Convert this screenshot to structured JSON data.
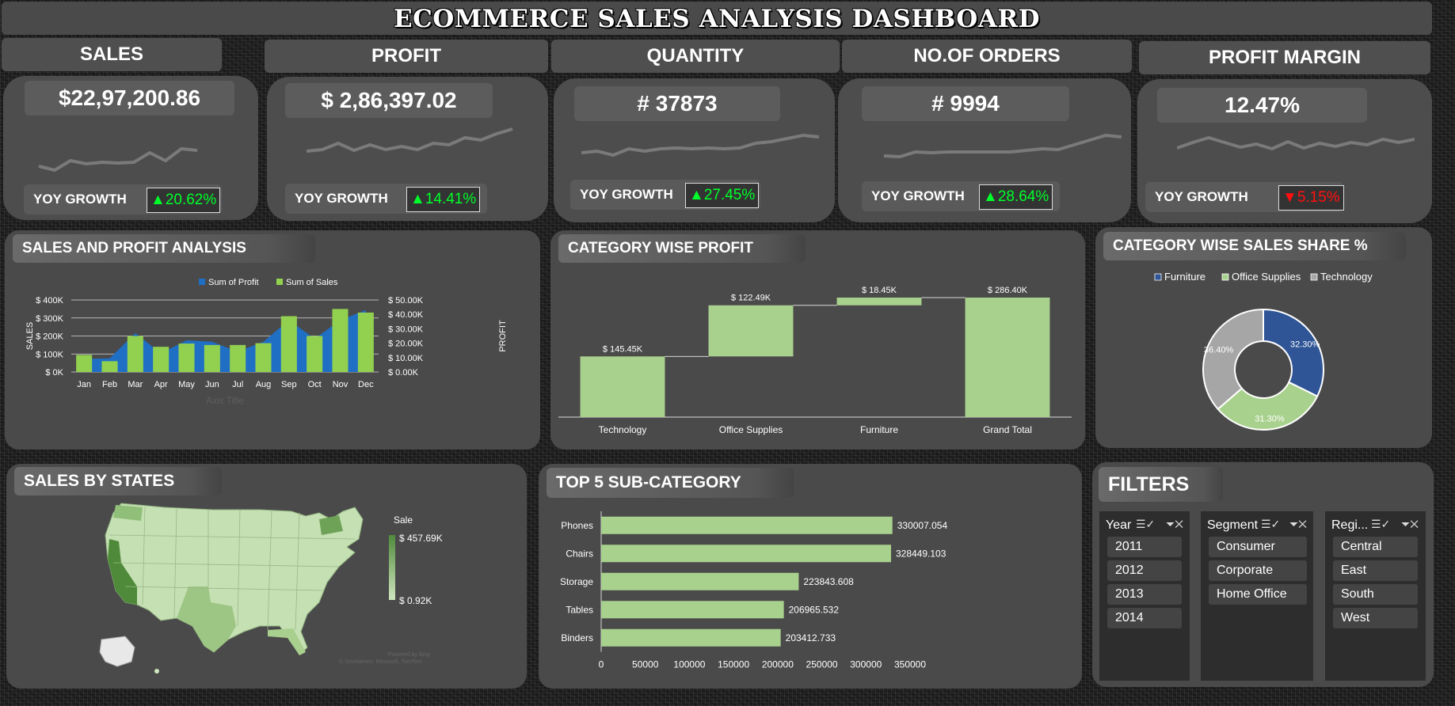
{
  "dashboard": {
    "title": "ECOMMERCE SALES ANALYSIS DASHBOARD"
  },
  "kpis": [
    {
      "label": "SALES",
      "value": "$22,97,200.86",
      "yoy_label": "YOY GROWTH",
      "yoy": "20.62%",
      "direction": "up",
      "color": "#00ff2a"
    },
    {
      "label": "PROFIT",
      "value": "$  2,86,397.02",
      "yoy_label": "YOY GROWTH",
      "yoy": "14.41%",
      "direction": "up",
      "color": "#00ff2a"
    },
    {
      "label": "QUANTITY",
      "value": "# 37873",
      "yoy_label": "YOY GROWTH",
      "yoy": "27.45%",
      "direction": "up",
      "color": "#00ff2a"
    },
    {
      "label": "NO.OF ORDERS",
      "value": "# 9994",
      "yoy_label": "YOY GROWTH",
      "yoy": "28.64%",
      "direction": "up",
      "color": "#00ff2a"
    },
    {
      "label": "PROFIT MARGIN",
      "value": "12.47%",
      "yoy_label": "YOY GROWTH",
      "yoy": "5.15%",
      "direction": "down",
      "color": "#ff1010"
    }
  ],
  "panels": {
    "sales_profit": "SALES AND PROFIT ANALYSIS",
    "category_profit": "CATEGORY WISE PROFIT",
    "category_share": "CATEGORY WISE SALES SHARE %",
    "states": "SALES BY STATES",
    "top5": "TOP 5 SUB-CATEGORY",
    "filters": "FILTERS"
  },
  "map": {
    "legend_title": "Sale",
    "legend_max": "$ 457.69K",
    "legend_min": "$ 0.92K",
    "attribution_1": "Powered by Bing",
    "attribution_2": "© GeoNames, Microsoft, TomTom"
  },
  "filters": {
    "year": {
      "label": "Year",
      "items": [
        "2011",
        "2012",
        "2013",
        "2014"
      ]
    },
    "segment": {
      "label": "Segment",
      "items": [
        "Consumer",
        "Corporate",
        "Home Office"
      ]
    },
    "region": {
      "label": "Regi...",
      "items": [
        "Central",
        "East",
        "South",
        "West"
      ]
    }
  },
  "chart_data": [
    {
      "type": "bar",
      "name": "Sales and Profit Analysis",
      "categories": [
        "Jan",
        "Feb",
        "Mar",
        "Apr",
        "May",
        "Jun",
        "Jul",
        "Aug",
        "Sep",
        "Oct",
        "Nov",
        "Dec"
      ],
      "series": [
        {
          "name": "Sum of Sales",
          "type": "bar",
          "axis": "left",
          "color": "#92d050",
          "values": [
            95000,
            60000,
            200000,
            140000,
            158000,
            150000,
            150000,
            160000,
            310000,
            200000,
            350000,
            330000
          ]
        },
        {
          "name": "Sum of Profit",
          "type": "area",
          "axis": "right",
          "color": "#1f6fc5",
          "values": [
            9000,
            9500,
            27000,
            13000,
            22000,
            21000,
            14000,
            21000,
            36000,
            23000,
            36000,
            43000
          ]
        }
      ],
      "ylabel": "SALES",
      "y2label": "PROFIT",
      "xlabel": "Axis Title",
      "ylim": [
        0,
        400000
      ],
      "y2lim": [
        0,
        50000
      ],
      "yticks": [
        "$ 0K",
        "$ 100K",
        "$ 200K",
        "$ 300K",
        "$ 400K"
      ],
      "y2ticks": [
        "$ 0.00K",
        "$ 10.00K",
        "$ 20.00K",
        "$ 30.00K",
        "$ 40.00K",
        "$ 50.00K"
      ],
      "legend": "top",
      "grid": true
    },
    {
      "type": "bar",
      "name": "Category Wise Profit (waterfall)",
      "categories": [
        "Technology",
        "Office Supplies",
        "Furniture",
        "Grand Total"
      ],
      "values": [
        145.45,
        122.49,
        18.45,
        286.4
      ],
      "labels": [
        "$ 145.45K",
        "$ 122.49K",
        "$ 18.45K",
        "$ 286.40K"
      ],
      "units": "K$",
      "waterfall": true,
      "color": "#a9d18e"
    },
    {
      "type": "pie",
      "name": "Category Wise Sales Share %",
      "donut": true,
      "categories": [
        "Furniture",
        "Office Supplies",
        "Technology"
      ],
      "values": [
        32.3,
        31.3,
        36.4
      ],
      "labels": [
        "32.30%",
        "31.30%",
        "36.40%"
      ],
      "colors": [
        "#2f5597",
        "#a9d18e",
        "#a6a6a6"
      ],
      "legend": "top"
    },
    {
      "type": "bar",
      "orientation": "horizontal",
      "name": "Top 5 Sub-Category",
      "categories": [
        "Phones",
        "Chairs",
        "Storage",
        "Tables",
        "Binders"
      ],
      "values": [
        330007.054,
        328449.103,
        223843.608,
        206965.532,
        203412.733
      ],
      "labels": [
        "330007.054",
        "328449.103",
        "223843.608",
        "206965.532",
        "203412.733"
      ],
      "xlim": [
        0,
        350000
      ],
      "xticks": [
        "0",
        "50000",
        "100000",
        "150000",
        "200000",
        "250000",
        "300000",
        "350000"
      ],
      "color": "#a9d18e"
    }
  ]
}
